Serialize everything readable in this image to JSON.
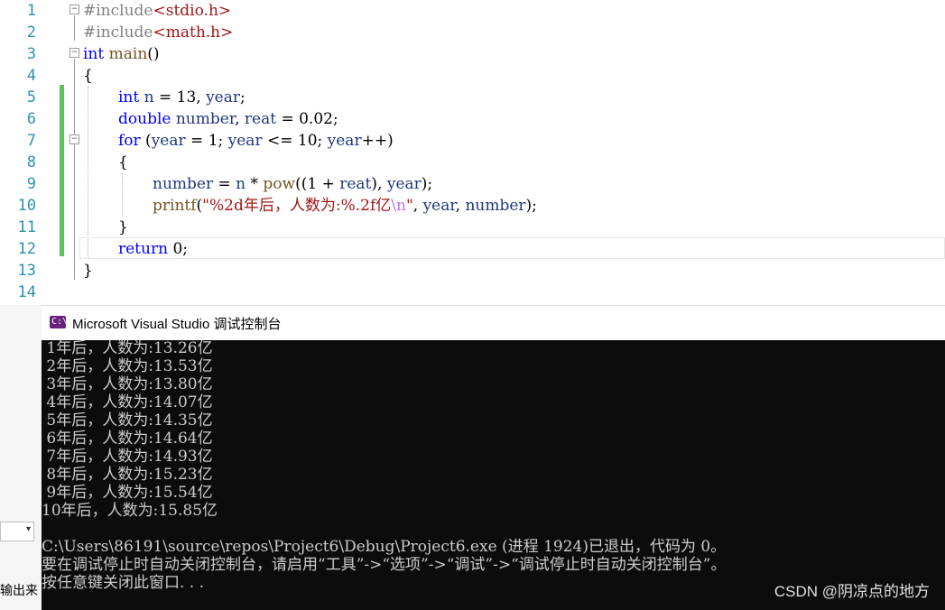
{
  "editor": {
    "line_numbers": [
      "1",
      "2",
      "3",
      "4",
      "5",
      "6",
      "7",
      "8",
      "9",
      "10",
      "11",
      "12",
      "13",
      "14"
    ],
    "lines": {
      "l1": {
        "pp": "#include",
        "inc": "<stdio.h>"
      },
      "l2": {
        "pp": "#include",
        "inc": "<math.h>"
      },
      "l3": {
        "kw": "int",
        "fn": "main",
        "rest": "()"
      },
      "l4": {
        "t": "{"
      },
      "l5": {
        "kw": "int",
        "id1": "n",
        "op1": " = 13, ",
        "id2": "year",
        "end": ";"
      },
      "l6": {
        "kw": "double",
        "id1": "number",
        "op1": ", ",
        "id2": "reat",
        "end": " = 0.02;"
      },
      "l7": {
        "kw": "for",
        "p1": " (",
        "id1": "year",
        "p2": " = 1; ",
        "id2": "year",
        "p3": " <= 10; ",
        "id3": "year",
        "p4": "++)"
      },
      "l8": {
        "t": "{"
      },
      "l9": {
        "id1": "number",
        "p1": " = ",
        "id2": "n",
        "p2": " * ",
        "fn": "pow",
        "p3": "((1 + ",
        "id3": "reat",
        "p4": "), ",
        "id4": "year",
        "p5": ");"
      },
      "l10": {
        "fn": "printf",
        "p1": "(",
        "str": "\"%2d年后，人数为:%.2f亿",
        "esc": "\\n",
        "str2": "\"",
        "p2": ", ",
        "id1": "year",
        "p3": ", ",
        "id2": "number",
        "p4": ");"
      },
      "l11": {
        "t": "}"
      },
      "l12": {
        "kw": "return",
        "end": " 0;"
      },
      "l13": {
        "t": "}"
      }
    },
    "fold_symbol": "−"
  },
  "console": {
    "title": "Microsoft Visual Studio 调试控制台",
    "icon_glyph": "C:\\",
    "output": [
      " 1年后，人数为:13.26亿",
      " 2年后，人数为:13.53亿",
      " 3年后，人数为:13.80亿",
      " 4年后，人数为:14.07亿",
      " 5年后，人数为:14.35亿",
      " 6年后，人数为:14.64亿",
      " 7年后，人数为:14.93亿",
      " 8年后，人数为:15.23亿",
      " 9年后，人数为:15.54亿",
      "10年后，人数为:15.85亿"
    ],
    "exit_message": "C:\\Users\\86191\\source\\repos\\Project6\\Debug\\Project6.exe (进程 1924)已退出，代码为 0。",
    "hint_message": "要在调试停止时自动关闭控制台，请启用“工具”->“选项”->“调试”->“调试停止时自动关闭控制台”。",
    "press_key_message": "按任意键关闭此窗口. . .",
    "watermark": "CSDN @阴凉点的地方"
  },
  "left_panel": {
    "dropdown_symbol": "▾",
    "label": "输出来"
  },
  "colors": {
    "console_bg": "#0c0c0c",
    "console_text": "#cccccc",
    "keyword": "#0000ff",
    "string": "#a31515",
    "change_bar": "#57c35a",
    "line_number": "#2b91af"
  }
}
